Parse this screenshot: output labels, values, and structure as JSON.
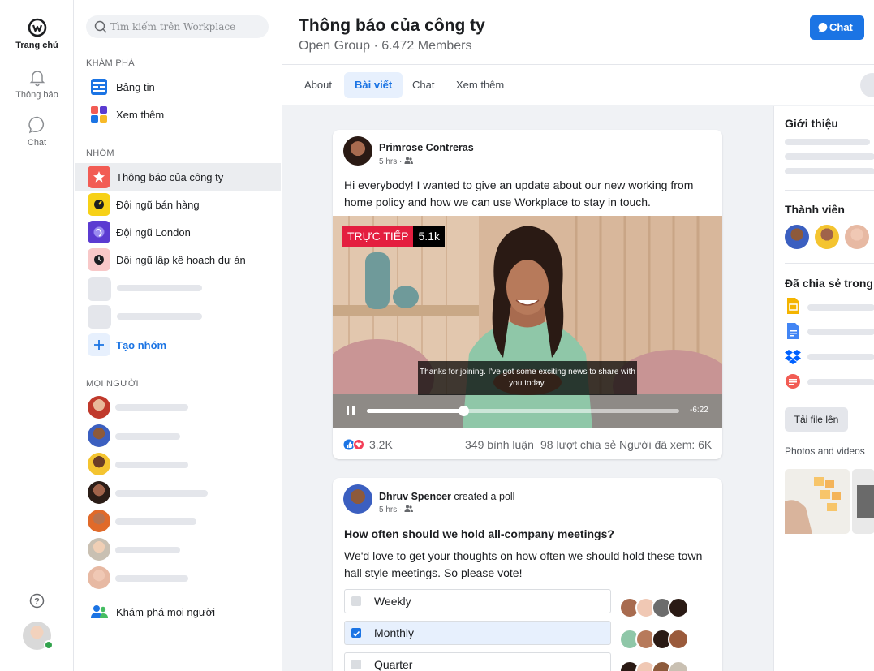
{
  "rail": {
    "items": [
      {
        "label": "Trang chủ"
      },
      {
        "label": "Thông báo"
      },
      {
        "label": "Chat"
      }
    ]
  },
  "sidebar": {
    "search_placeholder": "Tìm kiếm trên Workplace",
    "explore_title": "KHÁM PHÁ",
    "explore_items": [
      {
        "label": "Bảng tin"
      },
      {
        "label": "Xem thêm"
      }
    ],
    "groups_title": "NHÓM",
    "groups": [
      {
        "label": "Thông báo của công ty",
        "color": "#f25c54"
      },
      {
        "label": "Đội ngũ bán hàng",
        "color": "#f7d117"
      },
      {
        "label": "Đội ngũ London",
        "color": "#5b3bd1"
      },
      {
        "label": "Đội ngũ lập kế hoạch dự án",
        "color": "#f8c8c8"
      }
    ],
    "create_group": "Tạo nhóm",
    "people_title": "MỌI NGƯỜI",
    "explore_people": "Khám phá mọi người"
  },
  "header": {
    "title": "Thông báo của công ty",
    "subtitle": "Open Group · 6.472 Members",
    "chat_button": "Chat"
  },
  "tabs": [
    {
      "label": "About"
    },
    {
      "label": "Bài viết"
    },
    {
      "label": "Chat"
    },
    {
      "label": "Xem thêm"
    }
  ],
  "post1": {
    "author": "Primrose Contreras",
    "time": "5 hrs ·",
    "text": "Hi everybody! I wanted to give an update about our new working from home policy and how we can use Workplace to stay in touch.",
    "live_label": "TRỰC TIẾP",
    "viewers": "5.1k",
    "caption": "Thanks for joining. I've got some exciting news to share with you today.",
    "remaining": "-6:22",
    "progress": 0.31,
    "reactions": "3,2K",
    "comments": "349 bình luận",
    "shares": "98 lượt chia sẻ",
    "views": "Người đã xem: 6K"
  },
  "post2": {
    "author": "Dhruv Spencer",
    "action": " created a poll",
    "time": "5 hrs ·",
    "question": "How often should we hold all-company meetings?",
    "text": "We'd love to get your thoughts on how often we should hold these town hall style meetings. So please vote!",
    "options": [
      {
        "label": "Weekly",
        "checked": false
      },
      {
        "label": "Monthly",
        "checked": true
      },
      {
        "label": "Quarter",
        "checked": false
      }
    ]
  },
  "right": {
    "intro_title": "Giới thiệu",
    "members_title": "Thành viên",
    "shared_title": "Đã chia sẻ trong",
    "upload_label": "Tải file lên",
    "photos_title": "Photos and videos"
  }
}
